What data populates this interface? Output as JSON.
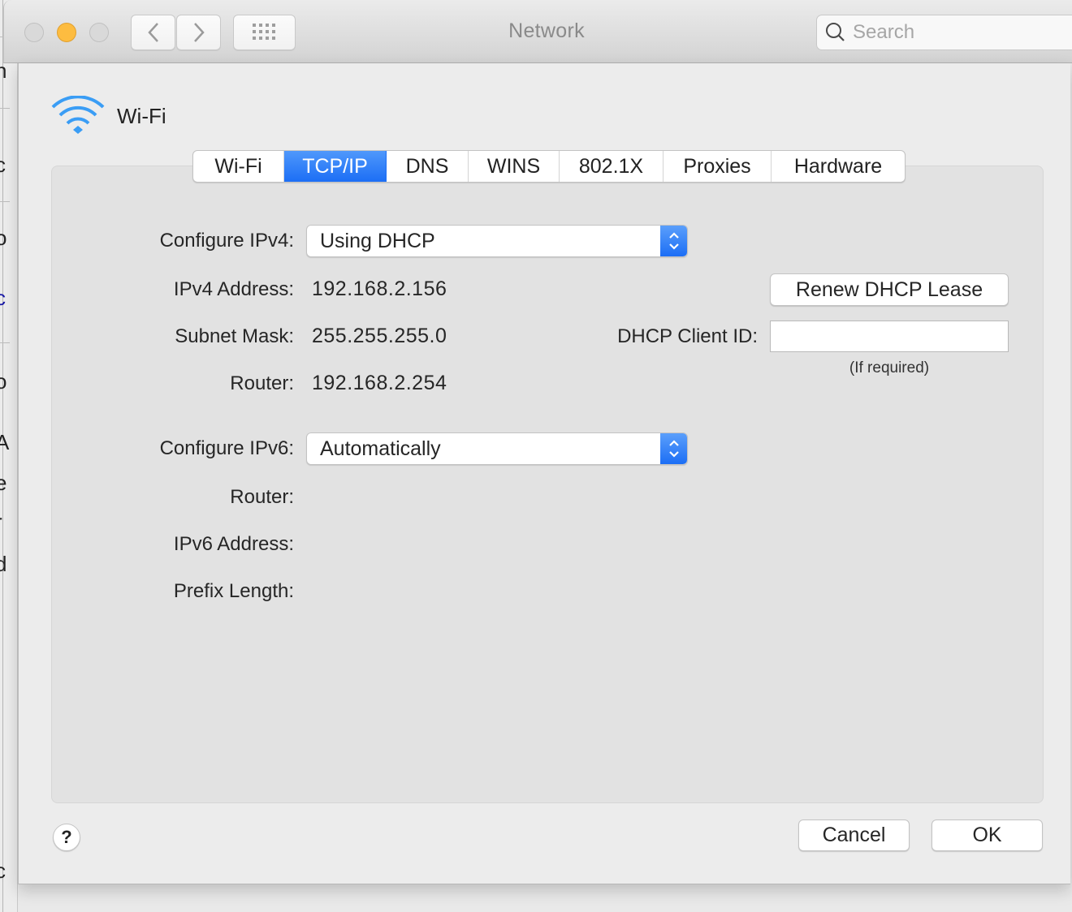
{
  "window": {
    "title": "Network",
    "search_placeholder": "Search",
    "icons": {
      "close": "traffic-light-close",
      "minimize": "traffic-light-minimize",
      "zoom": "traffic-light-zoom",
      "back": "chevron-left-icon",
      "forward": "chevron-right-icon",
      "show_all": "grid-icon",
      "search": "magnifier-icon"
    }
  },
  "interface": {
    "name": "Wi-Fi",
    "icon": "wifi-icon"
  },
  "tabs": [
    {
      "label": "Wi-Fi",
      "active": false
    },
    {
      "label": "TCP/IP",
      "active": true
    },
    {
      "label": "DNS",
      "active": false
    },
    {
      "label": "WINS",
      "active": false
    },
    {
      "label": "802.1X",
      "active": false
    },
    {
      "label": "Proxies",
      "active": false
    },
    {
      "label": "Hardware",
      "active": false
    }
  ],
  "ipv4": {
    "configure_label": "Configure IPv4:",
    "configure_value": "Using DHCP",
    "address_label": "IPv4 Address:",
    "address_value": "192.168.2.156",
    "subnet_label": "Subnet Mask:",
    "subnet_value": "255.255.255.0",
    "router_label": "Router:",
    "router_value": "192.168.2.254"
  },
  "dhcp": {
    "renew_button": "Renew DHCP Lease",
    "client_id_label": "DHCP Client ID:",
    "client_id_value": "",
    "client_id_hint": "(If required)"
  },
  "ipv6": {
    "configure_label": "Configure IPv6:",
    "configure_value": "Automatically",
    "router_label": "Router:",
    "router_value": "",
    "address_label": "IPv6 Address:",
    "address_value": "",
    "prefix_label": "Prefix Length:",
    "prefix_value": ""
  },
  "footer": {
    "help_label": "?",
    "cancel_label": "Cancel",
    "ok_label": "OK"
  },
  "colors": {
    "accent": "#1c6ef5",
    "minimize": "#fdbc40",
    "wifi": "#3a9df5"
  }
}
